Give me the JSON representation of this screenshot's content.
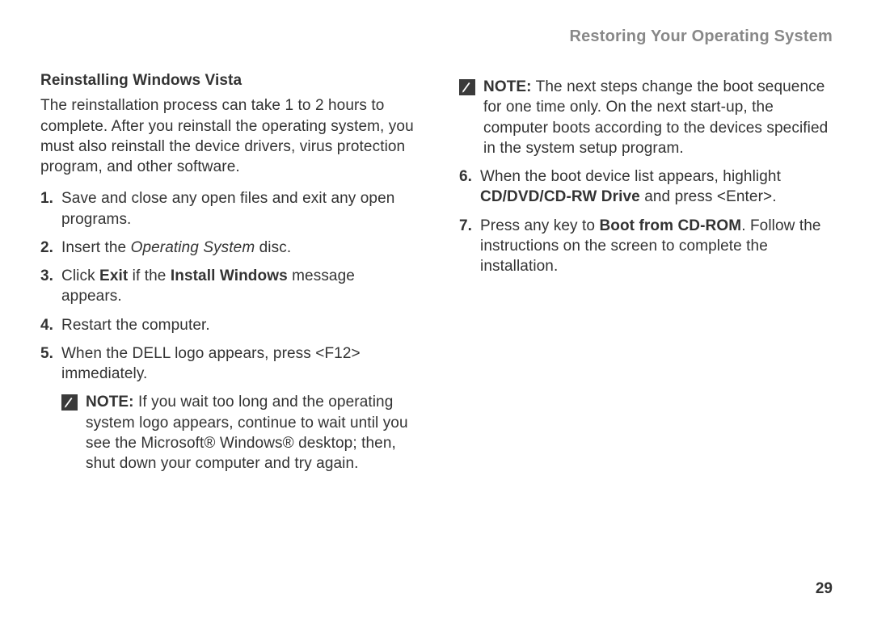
{
  "header": {
    "title": "Restoring Your Operating System"
  },
  "left": {
    "heading": "Reinstalling Windows Vista",
    "intro": "The reinstallation process can take 1 to 2 hours to complete. After you reinstall the operating system, you must also reinstall the device drivers, virus protection program, and other software.",
    "step1_num": "1.",
    "step1": "Save and close any open files and exit any open programs.",
    "step2_num": "2.",
    "step2_a": "Insert the ",
    "step2_b": "Operating System",
    "step2_c": " disc.",
    "step3_num": "3.",
    "step3_a": "Click ",
    "step3_b": "Exit",
    "step3_c": " if the ",
    "step3_d": "Install Windows",
    "step3_e": " message appears.",
    "step4_num": "4.",
    "step4": "Restart the computer.",
    "step5_num": "5.",
    "step5": "When the DELL logo appears, press <F12> immediately.",
    "note1_label": "NOTE:",
    "note1_text": " If you wait too long and the operating system logo appears, continue to wait until you see the Microsoft® Windows® desktop; then, shut down your computer and try again."
  },
  "right": {
    "note2_label": "NOTE:",
    "note2_text": " The next steps change the boot sequence for one time only. On the next start-up, the computer boots according to the devices specified in the system setup program.",
    "step6_num": "6.",
    "step6_a": "When the boot device list appears, highlight ",
    "step6_b": "CD/DVD/CD-RW Drive",
    "step6_c": " and press <Enter>.",
    "step7_num": "7.",
    "step7_a": "Press any key to ",
    "step7_b": "Boot from CD-ROM",
    "step7_c": ". Follow the instructions on the screen to complete the installation."
  },
  "page_number": "29",
  "icons": {
    "note": "note-icon"
  }
}
